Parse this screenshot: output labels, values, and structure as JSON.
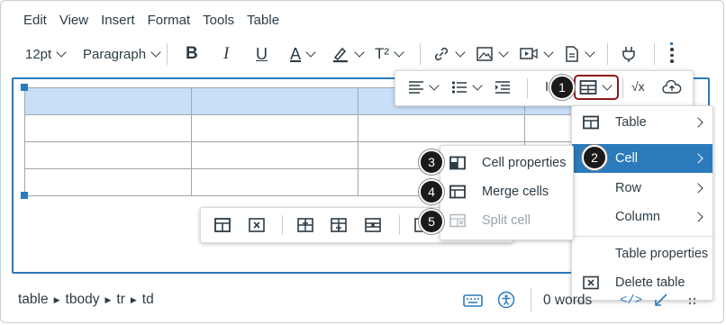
{
  "menubar": {
    "items": [
      "Edit",
      "View",
      "Insert",
      "Format",
      "Tools",
      "Table"
    ]
  },
  "toolbar": {
    "font_size": "12pt",
    "block_format": "Paragraph",
    "superscript": "T²"
  },
  "table_context_menu": {
    "items": [
      {
        "label": "Table",
        "icon": "table-icon",
        "submenu": true
      },
      {
        "label": "Cell",
        "icon": "",
        "submenu": true,
        "highlighted": true,
        "callout": "2"
      },
      {
        "label": "Row",
        "submenu": true
      },
      {
        "label": "Column",
        "submenu": true
      },
      {
        "label": "Table properties"
      },
      {
        "label": "Delete table",
        "icon": "delete-table-icon"
      }
    ]
  },
  "cell_submenu": {
    "items": [
      {
        "label": "Cell properties",
        "icon": "cell-properties-icon",
        "callout": "3",
        "disabled": false
      },
      {
        "label": "Merge cells",
        "icon": "merge-cells-icon",
        "callout": "4",
        "disabled": false
      },
      {
        "label": "Split cell",
        "icon": "split-cell-icon",
        "callout": "5",
        "disabled": true
      }
    ]
  },
  "callouts": {
    "table_button": "1"
  },
  "status": {
    "path": [
      "table",
      "tbody",
      "tr",
      "td"
    ],
    "word_count": "0 words"
  },
  "colors": {
    "accent": "#2b7abc",
    "highlight": "#2b7abc",
    "callout_ring": "#8b1a1a",
    "selected_cells": "#c8dff7"
  }
}
